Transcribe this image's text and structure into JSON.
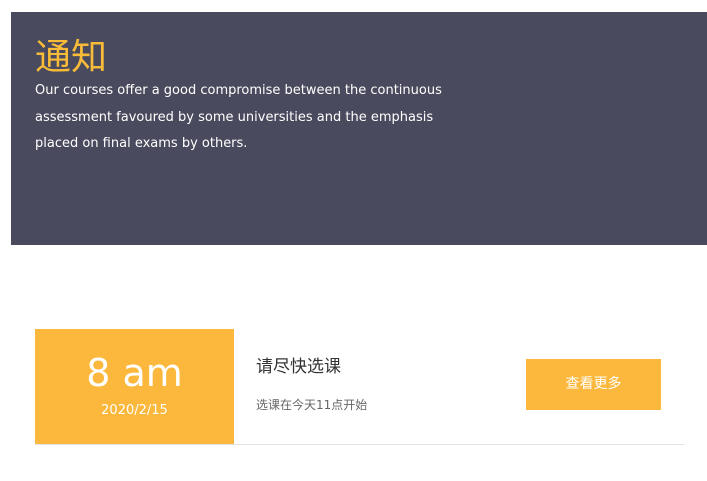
{
  "hero": {
    "title": "通知",
    "description": "Our courses offer a good compromise between the continuous assessment favoured by some universities and the emphasis placed on final exams by others."
  },
  "notice": {
    "time": "8 am",
    "date": "2020/2/15",
    "title": "请尽快选课",
    "subtitle": "选课在今天11点开始",
    "button_label": "查看更多"
  },
  "colors": {
    "hero_bg": "#4a4a5e",
    "accent": "#fbb83c",
    "title_accent": "#f9bc38"
  }
}
